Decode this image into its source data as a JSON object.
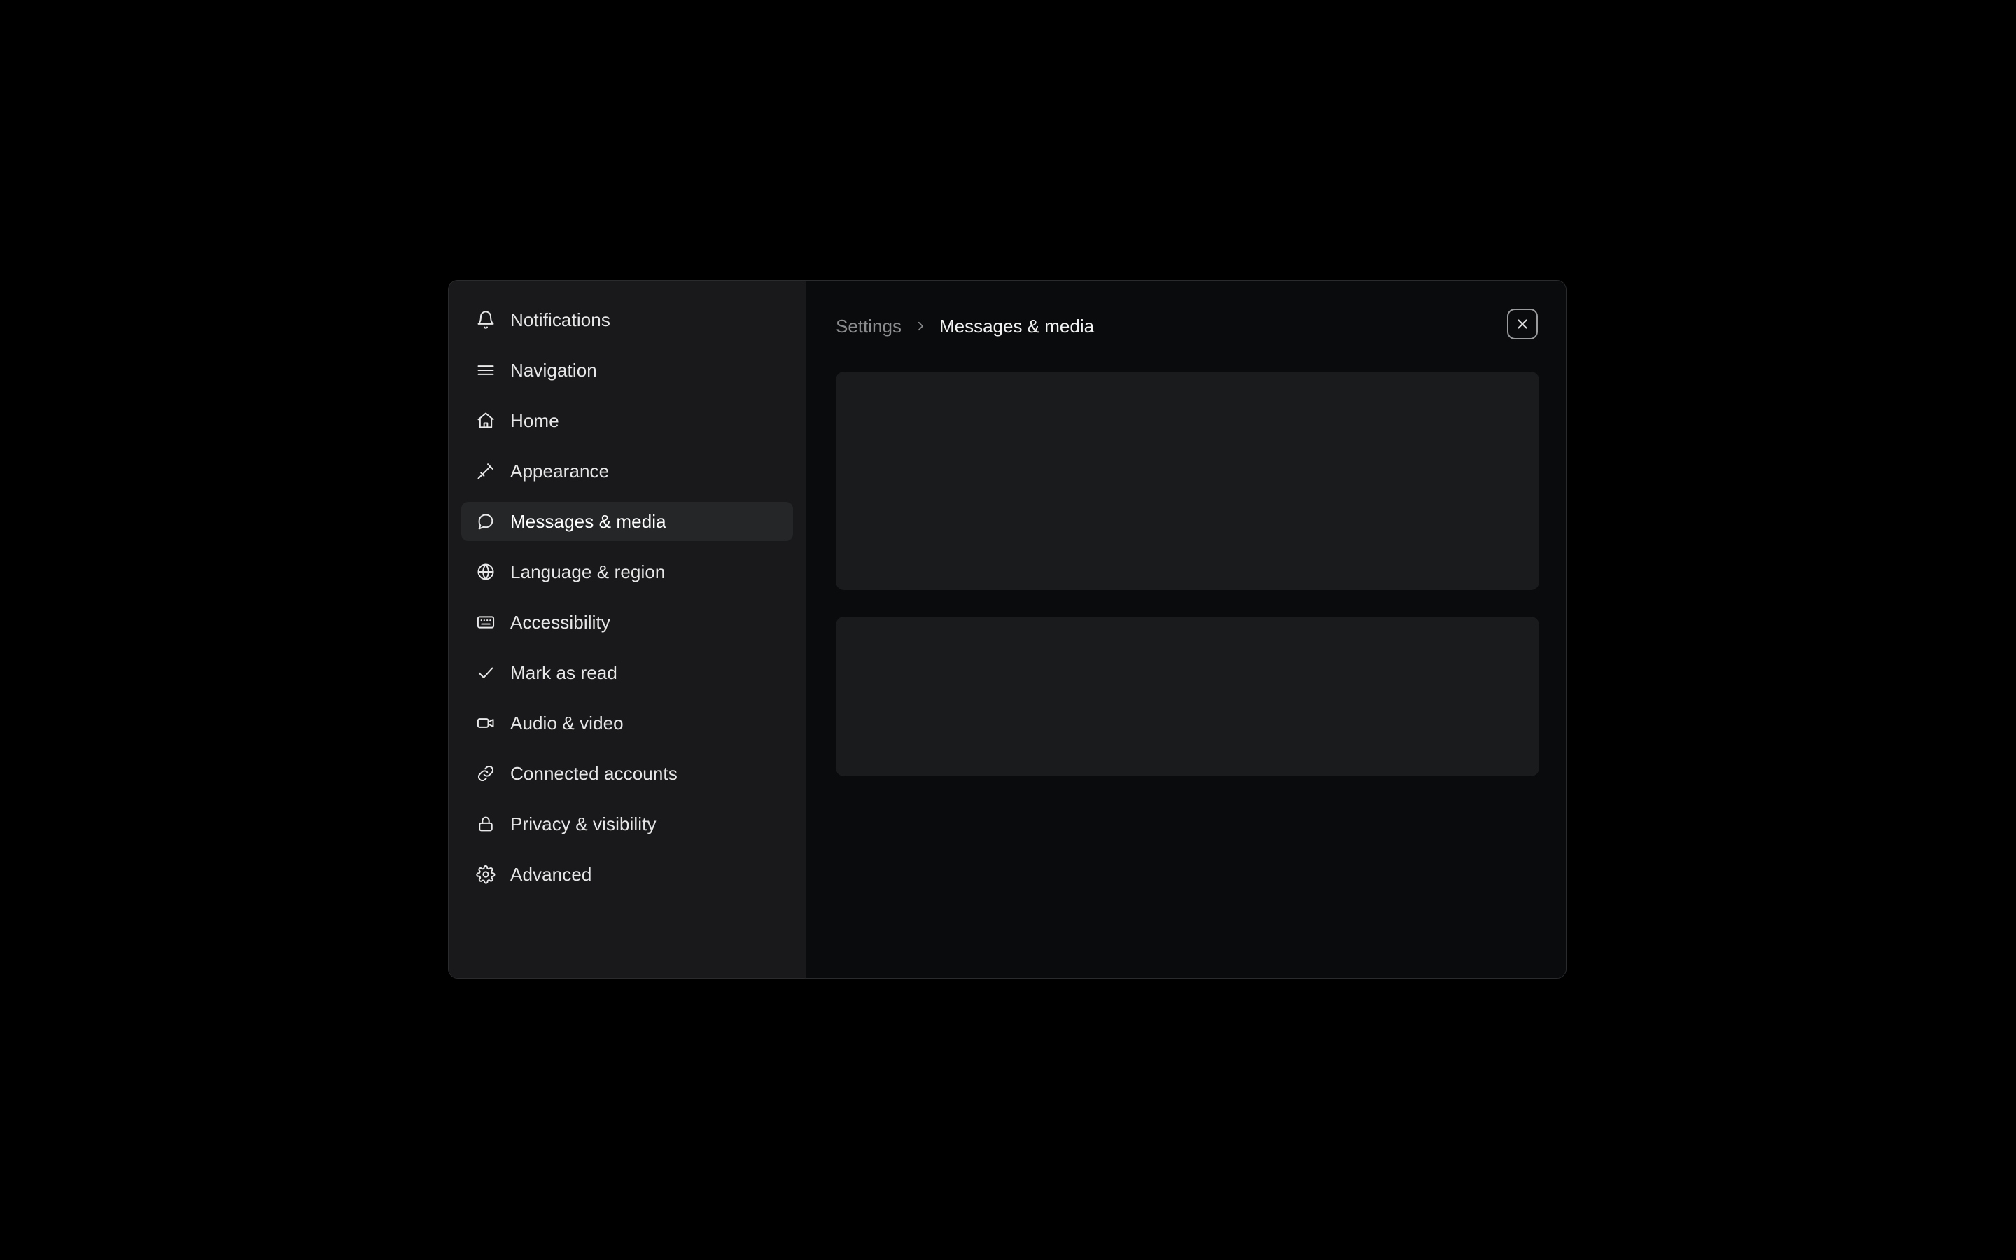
{
  "modal": {
    "title": "Settings",
    "background": "#0a0b0c",
    "border_color": "#2a2b2d"
  },
  "sidebar": {
    "background": "#19191b",
    "active_background": "#252628",
    "items": [
      {
        "label": "Notifications",
        "icon": "bell-icon",
        "active": false
      },
      {
        "label": "Navigation",
        "icon": "menu-icon",
        "active": false
      },
      {
        "label": "Home",
        "icon": "home-icon",
        "active": false
      },
      {
        "label": "Appearance",
        "icon": "paintbrush-icon",
        "active": false
      },
      {
        "label": "Messages & media",
        "icon": "message-icon",
        "active": true
      },
      {
        "label": "Language & region",
        "icon": "globe-icon",
        "active": false
      },
      {
        "label": "Accessibility",
        "icon": "keyboard-icon",
        "active": false
      },
      {
        "label": "Mark as read",
        "icon": "check-icon",
        "active": false
      },
      {
        "label": "Audio & video",
        "icon": "video-camera-icon",
        "active": false
      },
      {
        "label": "Connected accounts",
        "icon": "link-icon",
        "active": false
      },
      {
        "label": "Privacy & visibility",
        "icon": "lock-icon",
        "active": false
      },
      {
        "label": "Advanced",
        "icon": "gear-icon",
        "active": false
      }
    ]
  },
  "header": {
    "breadcrumb": {
      "root": "Settings",
      "separator": "chevron-right-icon",
      "current": "Messages & media"
    },
    "close": {
      "icon": "close-x-icon",
      "aria_label": "Close"
    }
  },
  "content": {
    "placeholder_color": "#1a1b1d",
    "cards": [
      {
        "name": "content-placeholder-1",
        "text": ""
      },
      {
        "name": "content-placeholder-2",
        "text": ""
      }
    ]
  }
}
